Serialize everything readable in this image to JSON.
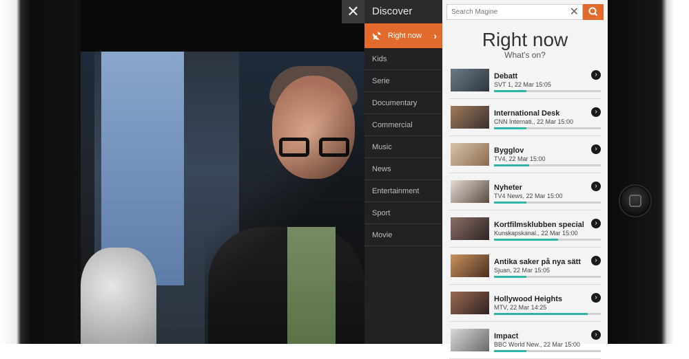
{
  "header": {
    "close_icon": "close-icon",
    "title": "Discover"
  },
  "menu": {
    "items": [
      {
        "label": "Right now",
        "active": true,
        "icon": "satellite-dish-icon"
      },
      {
        "label": "Kids"
      },
      {
        "label": "Serie"
      },
      {
        "label": "Documentary"
      },
      {
        "label": "Commercial"
      },
      {
        "label": "Music"
      },
      {
        "label": "News"
      },
      {
        "label": "Entertainment"
      },
      {
        "label": "Sport"
      },
      {
        "label": "Movie"
      }
    ]
  },
  "search": {
    "placeholder": "Search Magine"
  },
  "panel": {
    "title": "Right now",
    "subtitle": "What's on?"
  },
  "programs": [
    {
      "title": "Debatt",
      "subtitle": "SVT 1, 22 Mar 15:05",
      "progress": 0.3
    },
    {
      "title": "International Desk",
      "subtitle": "CNN Internati., 22 Mar 15:00",
      "progress": 0.3
    },
    {
      "title": "Bygglov",
      "subtitle": "TV4, 22 Mar 15:00",
      "progress": 0.33
    },
    {
      "title": "Nyheter",
      "subtitle": "TV4 News, 22 Mar 15:00",
      "progress": 0.3
    },
    {
      "title": "Kortfilmsklubben special",
      "subtitle": "Kunskapskanal., 22 Mar 15:00",
      "progress": 0.6
    },
    {
      "title": "Antika saker på nya sätt",
      "subtitle": "Sjuan, 22 Mar 15:05",
      "progress": 0.3
    },
    {
      "title": "Hollywood Heights",
      "subtitle": "MTV, 22 Mar 14:25",
      "progress": 0.88
    },
    {
      "title": "Impact",
      "subtitle": "BBC World New., 22 Mar 15:00",
      "progress": 0.3
    }
  ],
  "colors": {
    "accent": "#e26a2c",
    "progress": "#2fb5a8"
  }
}
